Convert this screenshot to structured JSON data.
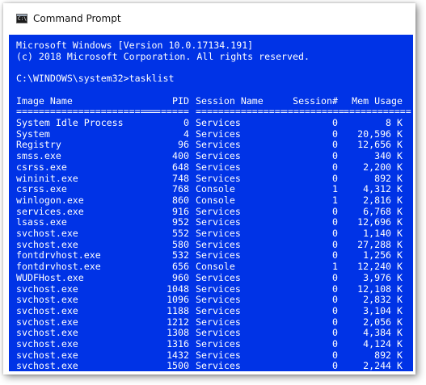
{
  "window": {
    "title": "Command Prompt",
    "icon": "cmd-icon",
    "icon_glyph": "C:\\",
    "bg_color": "#0033e6",
    "text_color": "#ffffff"
  },
  "console": {
    "banner_line1": "Microsoft Windows [Version 10.0.17134.191]",
    "banner_line2": "(c) 2018 Microsoft Corporation. All rights reserved.",
    "prompt_line": "C:\\WINDOWS\\system32>tasklist",
    "headers": {
      "image_name": "Image Name",
      "pid": "PID",
      "session_name": "Session Name",
      "session_num": "Session#",
      "mem_usage": "Mem Usage"
    },
    "separators": {
      "image_name": "=========================",
      "pid": "========",
      "session_name": "================",
      "session_num": "===========",
      "mem_usage": "============"
    },
    "rows": [
      {
        "image": "System Idle Process",
        "pid": "0",
        "session": "Services",
        "snum": "0",
        "mem": "8 K"
      },
      {
        "image": "System",
        "pid": "4",
        "session": "Services",
        "snum": "0",
        "mem": "20,596 K"
      },
      {
        "image": "Registry",
        "pid": "96",
        "session": "Services",
        "snum": "0",
        "mem": "12,656 K"
      },
      {
        "image": "smss.exe",
        "pid": "400",
        "session": "Services",
        "snum": "0",
        "mem": "340 K"
      },
      {
        "image": "csrss.exe",
        "pid": "648",
        "session": "Services",
        "snum": "0",
        "mem": "2,200 K"
      },
      {
        "image": "wininit.exe",
        "pid": "748",
        "session": "Services",
        "snum": "0",
        "mem": "892 K"
      },
      {
        "image": "csrss.exe",
        "pid": "768",
        "session": "Console",
        "snum": "1",
        "mem": "4,312 K"
      },
      {
        "image": "winlogon.exe",
        "pid": "860",
        "session": "Console",
        "snum": "1",
        "mem": "2,816 K"
      },
      {
        "image": "services.exe",
        "pid": "916",
        "session": "Services",
        "snum": "0",
        "mem": "6,768 K"
      },
      {
        "image": "lsass.exe",
        "pid": "952",
        "session": "Services",
        "snum": "0",
        "mem": "12,696 K"
      },
      {
        "image": "svchost.exe",
        "pid": "552",
        "session": "Services",
        "snum": "0",
        "mem": "1,140 K"
      },
      {
        "image": "svchost.exe",
        "pid": "580",
        "session": "Services",
        "snum": "0",
        "mem": "27,288 K"
      },
      {
        "image": "fontdrvhost.exe",
        "pid": "532",
        "session": "Services",
        "snum": "0",
        "mem": "1,256 K"
      },
      {
        "image": "fontdrvhost.exe",
        "pid": "656",
        "session": "Console",
        "snum": "1",
        "mem": "12,240 K"
      },
      {
        "image": "WUDFHost.exe",
        "pid": "960",
        "session": "Services",
        "snum": "0",
        "mem": "3,976 K"
      },
      {
        "image": "svchost.exe",
        "pid": "1048",
        "session": "Services",
        "snum": "0",
        "mem": "12,108 K"
      },
      {
        "image": "svchost.exe",
        "pid": "1096",
        "session": "Services",
        "snum": "0",
        "mem": "2,832 K"
      },
      {
        "image": "svchost.exe",
        "pid": "1188",
        "session": "Services",
        "snum": "0",
        "mem": "3,104 K"
      },
      {
        "image": "svchost.exe",
        "pid": "1212",
        "session": "Services",
        "snum": "0",
        "mem": "2,056 K"
      },
      {
        "image": "svchost.exe",
        "pid": "1308",
        "session": "Services",
        "snum": "0",
        "mem": "4,384 K"
      },
      {
        "image": "svchost.exe",
        "pid": "1316",
        "session": "Services",
        "snum": "0",
        "mem": "4,124 K"
      },
      {
        "image": "svchost.exe",
        "pid": "1432",
        "session": "Services",
        "snum": "0",
        "mem": "892 K"
      },
      {
        "image": "svchost.exe",
        "pid": "1500",
        "session": "Services",
        "snum": "0",
        "mem": "2,244 K"
      }
    ]
  }
}
